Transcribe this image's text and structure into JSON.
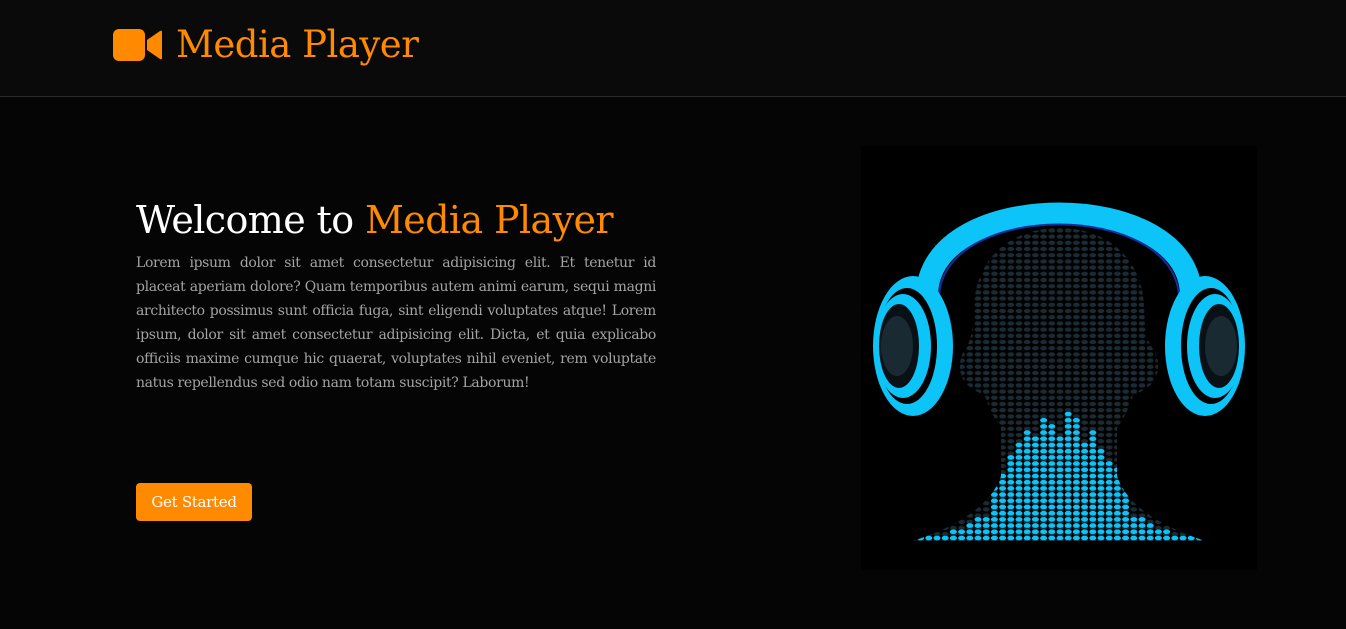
{
  "header": {
    "logo_icon": "video-camera-icon",
    "title": "Media Player"
  },
  "hero": {
    "title_prefix": "Welcome to ",
    "title_accent": "Media Player",
    "description": "Lorem ipsum dolor sit amet consectetur adipisicing elit. Et tenetur id placeat aperiam dolore? Quam temporibus autem animi earum, sequi magni architecto possimus sunt officia fuga, sint eligendi voluptates atque! Lorem ipsum, dolor sit amet consectetur adipisicing elit. Dicta, et quia explicabo officiis maxime cumque hic quaerat, voluptates nihil eveniet, rem voluptate natus repellendus sed odio nam totam suscipit? Laborum!",
    "cta_label": "Get Started",
    "image_icon": "headphones-equalizer-head-icon"
  },
  "colors": {
    "accent": "#ff8a00",
    "background": "#050505",
    "header_bg": "#0a0a0a",
    "headphone_blue": "#0cc4f7"
  }
}
